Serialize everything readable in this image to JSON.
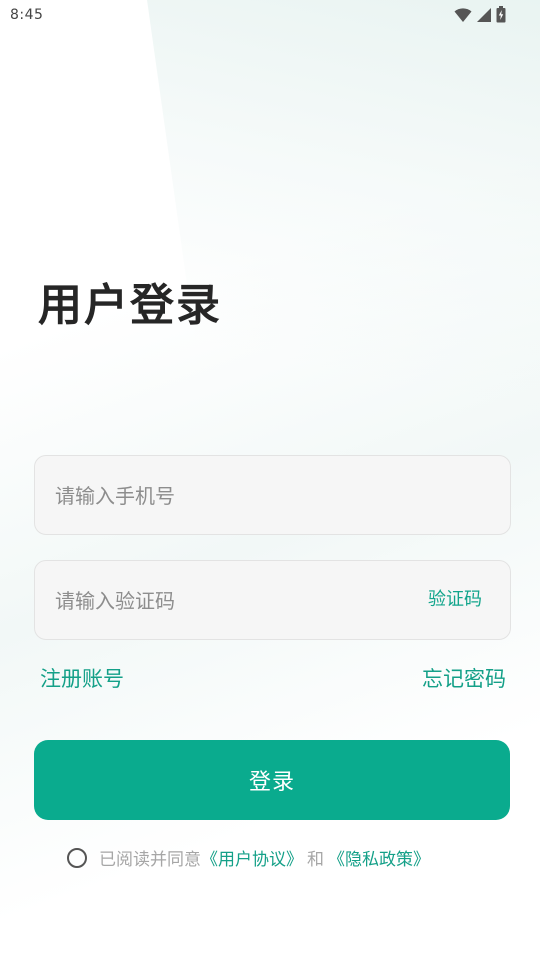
{
  "status_bar": {
    "time": "8:45",
    "icons": [
      "wifi-icon",
      "cell-signal-icon",
      "battery-charging-icon"
    ]
  },
  "title": "用户登录",
  "phone_input": {
    "placeholder": "请输入手机号",
    "value": ""
  },
  "code_input": {
    "placeholder": "请输入验证码",
    "value": "",
    "send_code_label": "验证码"
  },
  "links": {
    "register": "注册账号",
    "forgot_password": "忘记密码"
  },
  "login_button": "登录",
  "agreement": {
    "prefix": "已阅读并同意",
    "user_agreement": "《用户协议》",
    "conjunction": "和",
    "privacy_policy": "《隐私政策》",
    "checked": false
  },
  "colors": {
    "accent": "#0aab8e",
    "link": "#14a088",
    "title": "#262626",
    "field_bg": "#f6f6f6"
  }
}
